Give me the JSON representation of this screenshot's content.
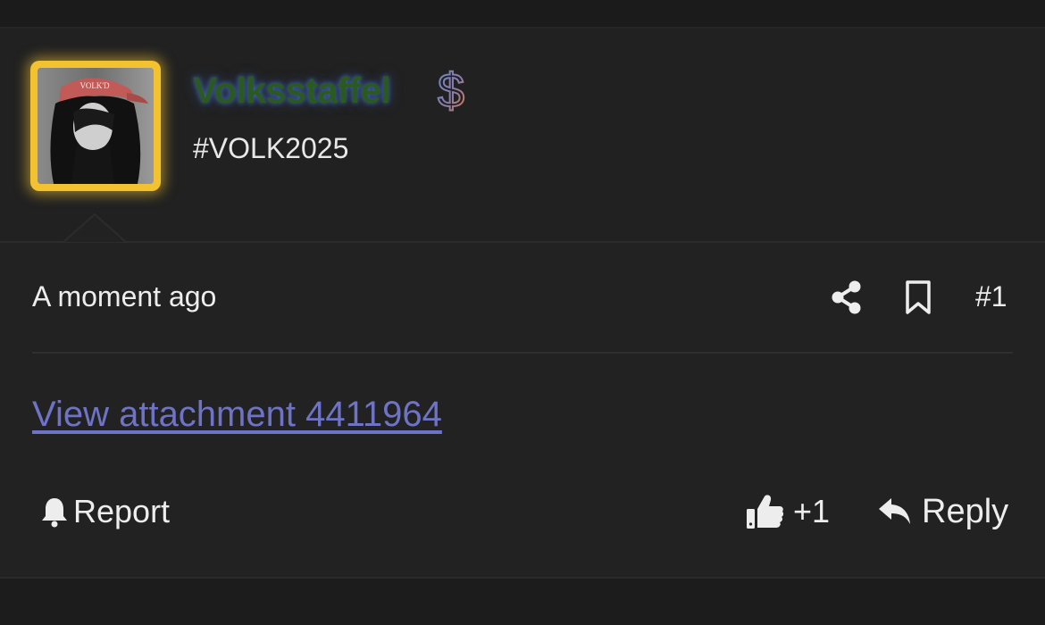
{
  "post": {
    "username": "Volksstaffel",
    "user_title": "#VOLK2025",
    "timestamp": "A moment ago",
    "post_number": "#1",
    "attachment_link": "View attachment 4411964",
    "report_label": "Report",
    "like_count": "+1",
    "reply_label": "Reply",
    "avatar_cap_text": "VOLK'D"
  },
  "icons": {
    "badge": "dollar-sign-icon",
    "share": "share-icon",
    "bookmark": "bookmark-icon",
    "report": "bell-icon",
    "like": "thumbs-up-icon",
    "reply": "reply-icon"
  },
  "colors": {
    "username": "#2a5a22",
    "username_glow": "#4670c8",
    "avatar_border": "#f2c230",
    "link": "#6f73c6",
    "background": "#222222"
  }
}
